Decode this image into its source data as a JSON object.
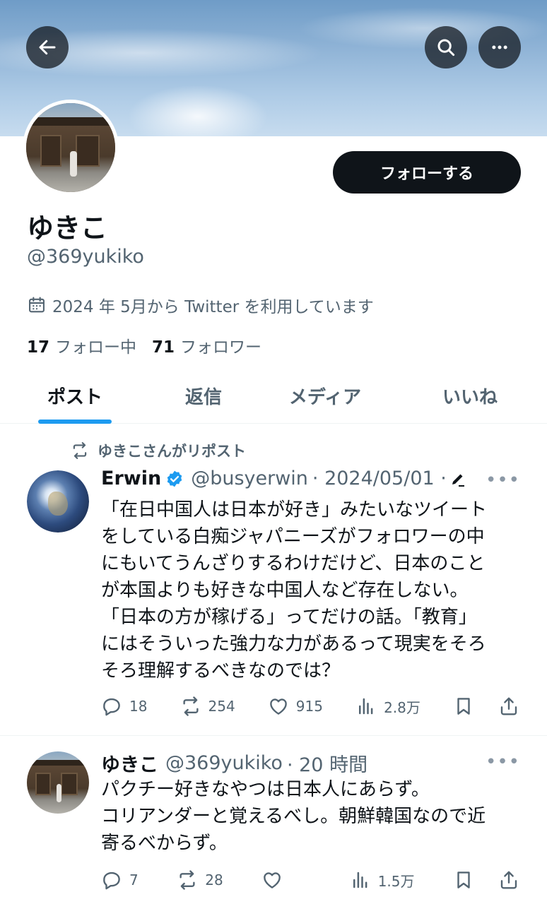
{
  "profile": {
    "name": "ゆきこ",
    "handle": "@369yukiko",
    "joined": "2024 年 5月から Twitter を利用しています",
    "following_count": "17",
    "following_label": "フォロー中",
    "followers_count": "71",
    "followers_label": "フォロワー",
    "follow_button": "フォローする"
  },
  "tabs": [
    {
      "label": "ポスト",
      "active": true
    },
    {
      "label": "返信",
      "active": false
    },
    {
      "label": "メディア",
      "active": false
    },
    {
      "label": "いいね",
      "active": false
    }
  ],
  "posts": [
    {
      "repost_label": "ゆきこさんがリポスト",
      "author_name": "Erwin",
      "author_handle": "@busyerwin",
      "date": "· 2024/05/01 ·",
      "text": "「在日中国人は日本が好き」みたいなツイート\nをしている白痴ジャパニーズがフォロワーの中\nにもいてうんざりするわけだけど、日本のこと\nが本国よりも好きな中国人など存在しない。\n「日本の方が稼げる」ってだけの話。「教育」\nにはそういった強力な力があるって現実をそろ\nそろ理解するべきなのでは？",
      "replies": "18",
      "reposts": "254",
      "likes": "915",
      "views": "2.8万"
    },
    {
      "author_name": "ゆきこ",
      "author_handle": "@369yukiko",
      "date": "· 20 時間",
      "text": "パクチー好きなやつは日本人にあらず。\nコリアンダーと覚えるべし。朝鮮韓国なので近\n寄るべからず。",
      "replies": "7",
      "reposts": "28",
      "likes": "",
      "views": "1.5万"
    }
  ],
  "more_label": "•••",
  "colors": {
    "accent": "#1d9bf0",
    "text": "#0f1419",
    "muted": "#536471"
  }
}
